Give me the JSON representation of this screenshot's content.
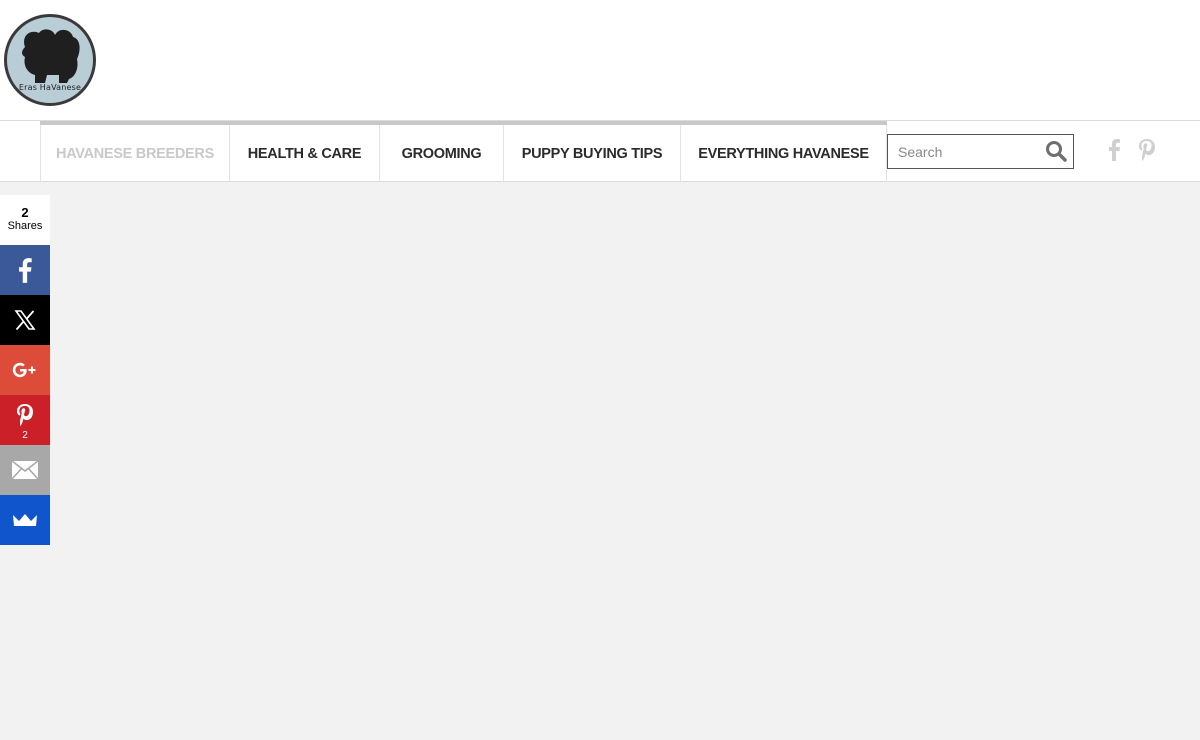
{
  "logo": {
    "text": "Eras HaVanese"
  },
  "nav": {
    "items": [
      {
        "label": "HAVANESE BREEDERS",
        "active": true
      },
      {
        "label": "HEALTH & CARE",
        "active": false
      },
      {
        "label": "GROOMING",
        "active": false
      },
      {
        "label": "PUPPY BUYING TIPS",
        "active": false
      },
      {
        "label": "EVERYTHING HAVANESE",
        "active": false
      }
    ],
    "active_color": "#c9c9c9"
  },
  "search": {
    "placeholder": "Search",
    "value": ""
  },
  "social_header": {
    "icons": [
      "facebook-icon",
      "pinterest-icon"
    ]
  },
  "share_bar": {
    "total_count": "2",
    "total_label": "Shares",
    "buttons": [
      {
        "icon": "facebook-icon",
        "color": "#3b5998",
        "count": ""
      },
      {
        "icon": "x-icon",
        "color": "#000000",
        "count": ""
      },
      {
        "icon": "google-plus-icon",
        "color": "#dd4b39",
        "count": ""
      },
      {
        "icon": "pinterest-icon",
        "color": "#cb2027",
        "count": "2"
      },
      {
        "icon": "email-icon",
        "color": "#a8a8a8",
        "count": ""
      },
      {
        "icon": "sumome-crown-icon",
        "color": "#1155cc",
        "count": ""
      }
    ]
  }
}
